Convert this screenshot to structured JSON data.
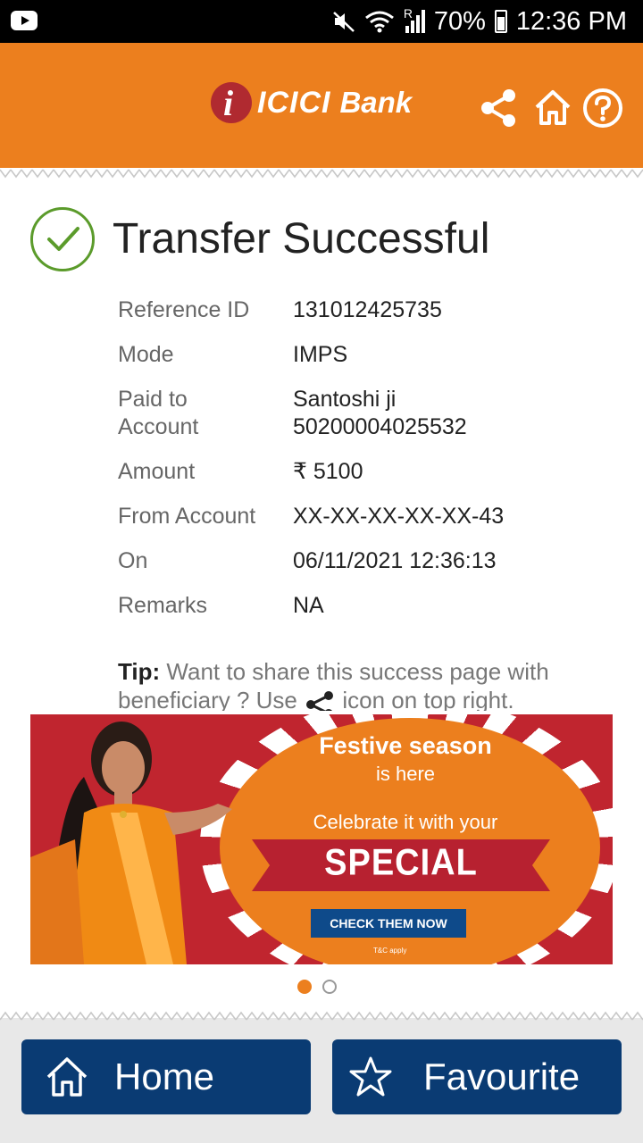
{
  "status_bar": {
    "battery": "70%",
    "time": "12:36 PM",
    "signal_text": "R",
    "icons": [
      "youtube-icon",
      "mute-icon",
      "wifi-icon",
      "signal-icon",
      "battery-icon"
    ]
  },
  "header": {
    "brand_part1": "ICICI",
    "brand_part2": "Bank",
    "background_color": "#ec7f1e",
    "icons": [
      "share-icon",
      "home-icon",
      "help-icon"
    ]
  },
  "result": {
    "title": "Transfer Successful",
    "status_color": "#5b9b2b"
  },
  "details": [
    {
      "label": "Reference ID",
      "value": "131012425735"
    },
    {
      "label": "Mode",
      "value": "IMPS"
    },
    {
      "label": "Paid to Account",
      "value": "Santoshi ji 50200004025532"
    },
    {
      "label": "Amount",
      "value": "₹ 5100"
    },
    {
      "label": "From Account",
      "value": "XX-XX-XX-XX-XX-43"
    },
    {
      "label": "On",
      "value": "06/11/2021 12:36:13"
    },
    {
      "label": "Remarks",
      "value": "NA"
    }
  ],
  "tip": {
    "prefix": "Tip:",
    "text_before_icon": " Want to share this success page with beneficiary ? Use ",
    "text_after_icon": " icon on top right."
  },
  "banner": {
    "line1": "Festive season",
    "line2": "is here",
    "line3": "Celebrate it with your",
    "headline": "SPECIAL OFFERS",
    "cta": "CHECK THEM NOW",
    "tc": "T&C apply",
    "current_slide": 1,
    "total_slides": 2
  },
  "bottom_bar": {
    "home_label": "Home",
    "favourite_label": "Favourite",
    "button_color": "#0a3b73"
  }
}
